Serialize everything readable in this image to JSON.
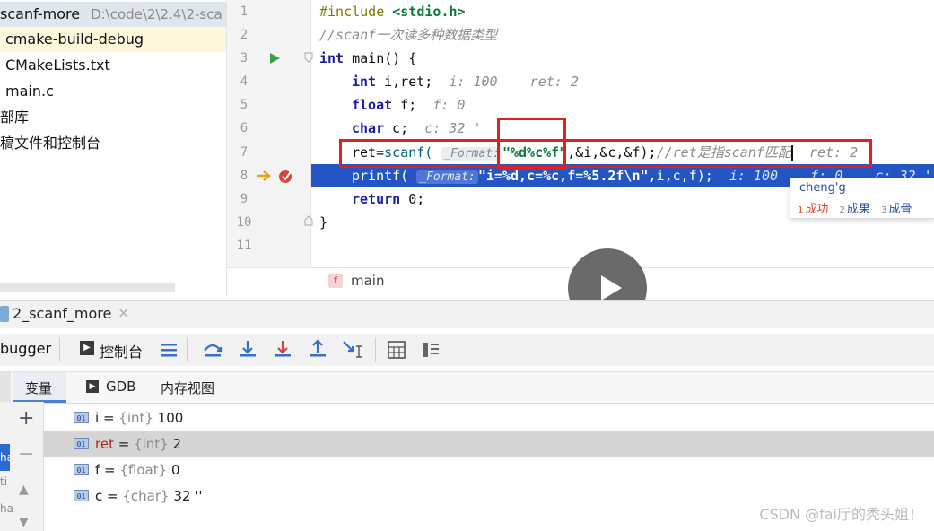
{
  "project": {
    "header_name": "scanf-more",
    "header_path": "D:\\code\\2\\2.4\\2-sca",
    "items": [
      "cmake-build-debug",
      "CMakeLists.txt",
      "main.c",
      "部库",
      "稿文件和控制台"
    ]
  },
  "editor": {
    "line_numbers": [
      "1",
      "2",
      "3",
      "4",
      "5",
      "6",
      "7",
      "8",
      "9",
      "10",
      "11"
    ],
    "l1_directive": "#include ",
    "l1_header": "<stdio.h>",
    "l2_comment": "//scanf一次读多种数据类型",
    "l3_kw": "int",
    "l3_rest": " main() {",
    "l4_kw": "int",
    "l4_rest": " i,ret;",
    "l4_inline": "i: 100    ret: 2",
    "l5_kw": "float",
    "l5_rest": " f;",
    "l5_inline": "f: 0",
    "l6_kw": "char",
    "l6_rest": " c;",
    "l6_inline": "c: 32 '",
    "l7_pre": "ret=",
    "l7_fn": "scanf(",
    "l7_hint": "_Format:",
    "l7_str": "\"%d%c%f\"",
    "l7_args": ",&i,&c,&f);",
    "l7_comment": "//ret是指scanf匹配",
    "l7_inline": "ret: 2",
    "l8_fn": "printf(",
    "l8_hint": "_Format:",
    "l8_str": "\"i=%d,c=%c,f=%5.2f\\n\"",
    "l8_args": ",i,c,f);",
    "l8_inline": "i: 100    f: 0    c: 32 '",
    "l9_kw": "return",
    "l9_rest": " 0;",
    "l10": "}",
    "breadcrumb_icon": "f",
    "breadcrumb": "main"
  },
  "ime": {
    "composition": "cheng'g",
    "candidates": [
      {
        "n": "1",
        "text": "成功"
      },
      {
        "n": "2",
        "text": "成果"
      },
      {
        "n": "3",
        "text": "成骨"
      }
    ]
  },
  "debug": {
    "tab_label": "2_scanf_more",
    "toolbar": {
      "debugger": "bugger",
      "console": "控制台"
    },
    "subtabs": {
      "variables": "变量",
      "gdb": "GDB",
      "memory": "内存视图"
    },
    "variables": [
      {
        "name": "i",
        "type": "{int}",
        "value": "100"
      },
      {
        "name": "ret",
        "type": "{int}",
        "value": "2"
      },
      {
        "name": "f",
        "type": "{float}",
        "value": "0"
      },
      {
        "name": "c",
        "type": "{char}",
        "value": "32 ''"
      }
    ],
    "badge": "01",
    "left_fragments": [
      "ha",
      "ti",
      "ha"
    ]
  },
  "watermark": "CSDN @fai厅的秃头姐！",
  "colors": {
    "exec_line": "#2355c4",
    "highlight_box": "#e11f1f",
    "selected_row": "#d5d5d5"
  }
}
